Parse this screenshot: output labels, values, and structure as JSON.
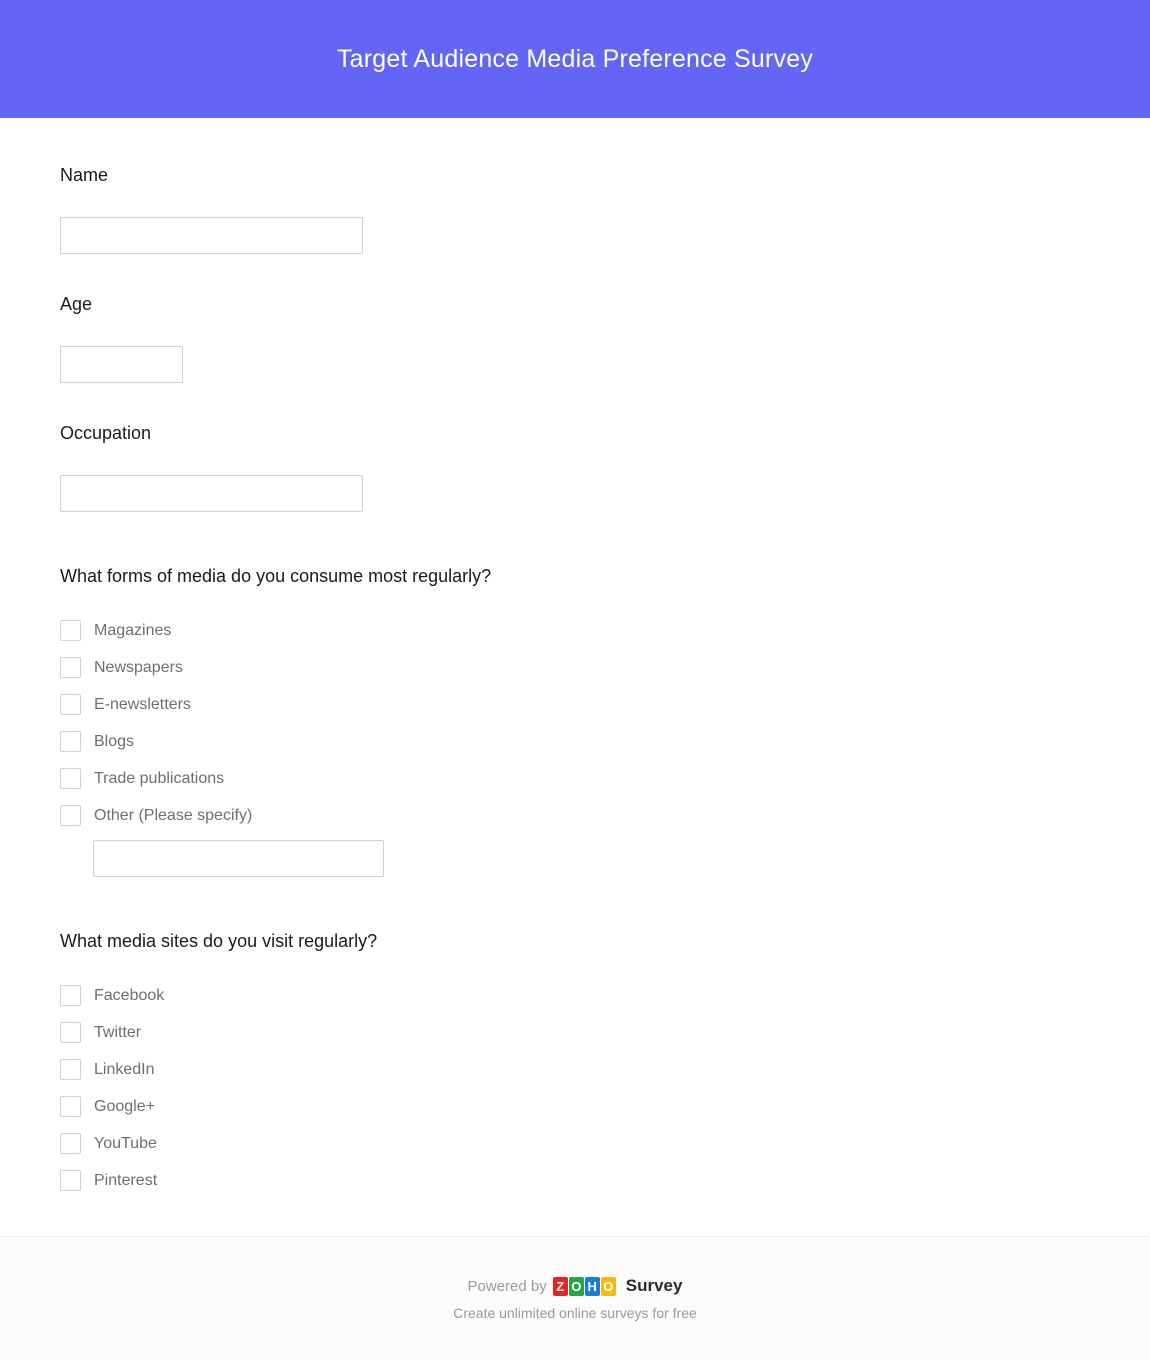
{
  "header": {
    "title": "Target Audience Media Preference Survey",
    "background_color": "#6366F5",
    "title_color": "#FFFFFF"
  },
  "form": {
    "fields": [
      {
        "label": "Name",
        "value": "",
        "placeholder": "",
        "size": "wide"
      },
      {
        "label": "Age",
        "value": "",
        "placeholder": "",
        "size": "short"
      },
      {
        "label": "Occupation",
        "value": "",
        "placeholder": "",
        "size": "wide"
      }
    ],
    "questions": [
      {
        "text": "What forms of media do you consume most regularly?",
        "options": [
          {
            "label": "Magazines",
            "checked": false
          },
          {
            "label": "Newspapers",
            "checked": false
          },
          {
            "label": "E-newsletters",
            "checked": false
          },
          {
            "label": "Blogs",
            "checked": false
          },
          {
            "label": "Trade publications",
            "checked": false
          },
          {
            "label": "Other (Please specify)",
            "checked": false
          }
        ],
        "other_input": {
          "value": "",
          "placeholder": ""
        }
      },
      {
        "text": "What media sites do you visit regularly?",
        "options": [
          {
            "label": "Facebook",
            "checked": false
          },
          {
            "label": "Twitter",
            "checked": false
          },
          {
            "label": "LinkedIn",
            "checked": false
          },
          {
            "label": "Google+",
            "checked": false
          },
          {
            "label": "YouTube",
            "checked": false
          },
          {
            "label": "Pinterest",
            "checked": false
          }
        ]
      }
    ]
  },
  "footer": {
    "powered_by": "Powered by",
    "logo_letters": [
      "Z",
      "O",
      "H",
      "O"
    ],
    "logo_colors": [
      "#E42527",
      "#29A643",
      "#1B7FD1",
      "#F6B90D"
    ],
    "product_name": "Survey",
    "tagline": "Create unlimited online surveys for free"
  }
}
